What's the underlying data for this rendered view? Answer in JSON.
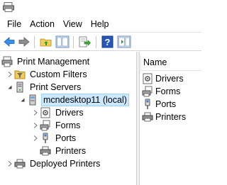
{
  "menu": [
    "File",
    "Action",
    "View",
    "Help"
  ],
  "toolbar": {
    "buttons": [
      "back-icon",
      "forward-icon",
      "up-folder-icon",
      "show-hide-tree-icon",
      "export-list-icon",
      "help-icon",
      "show-hide-action-pane-icon"
    ]
  },
  "tree": {
    "root": "Print Management",
    "custom_filters": "Custom Filters",
    "print_servers": "Print Servers",
    "server": "mcndesktop11 (local)",
    "drivers": "Drivers",
    "forms": "Forms",
    "ports": "Ports",
    "printers": "Printers",
    "deployed_printers": "Deployed Printers"
  },
  "list": {
    "header_name": "Name",
    "items": [
      "Drivers",
      "Forms",
      "Ports",
      "Printers"
    ]
  },
  "colors": {
    "selection_bg": "#cce8ff",
    "selection_border": "#99d1ff"
  }
}
